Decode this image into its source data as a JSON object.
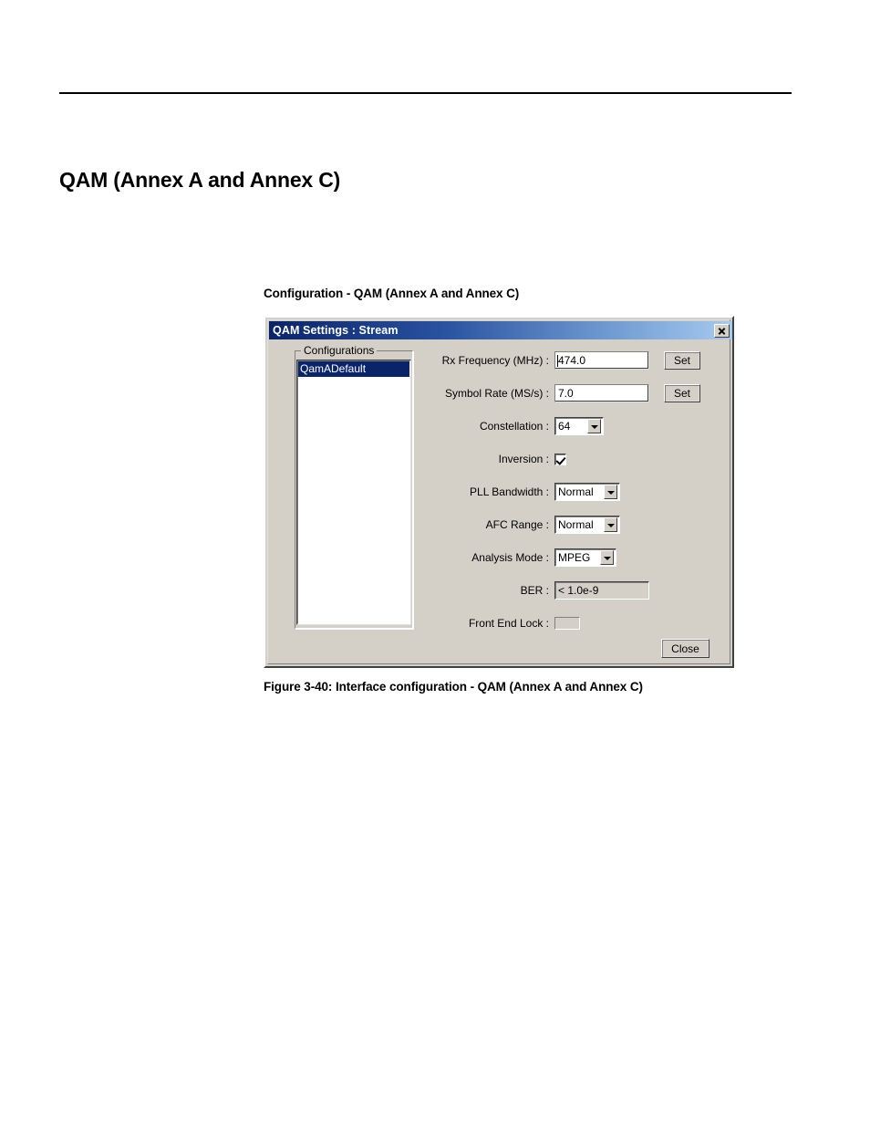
{
  "document": {
    "heading": "QAM (Annex A and Annex C)",
    "figure_label": "Configuration - QAM (Annex A and Annex C)",
    "figure_caption": "Figure 3-40: Interface configuration - QAM (Annex A and Annex C)"
  },
  "dialog": {
    "title": "QAM Settings : Stream",
    "close_icon": "close-x-icon",
    "configurations": {
      "group_label": "Configurations",
      "items": [
        {
          "label": "QamADefault",
          "selected": true
        }
      ]
    },
    "fields": {
      "rx_frequency": {
        "label": "Rx Frequency (MHz) :",
        "value": "474.0",
        "button": "Set"
      },
      "symbol_rate": {
        "label": "Symbol Rate (MS/s) :",
        "value": "7.0",
        "button": "Set"
      },
      "constellation": {
        "label": "Constellation :",
        "value": "64"
      },
      "inversion": {
        "label": "Inversion :",
        "checked": true
      },
      "pll_bandwidth": {
        "label": "PLL Bandwidth :",
        "value": "Normal"
      },
      "afc_range": {
        "label": "AFC Range :",
        "value": "Normal"
      },
      "analysis_mode": {
        "label": "Analysis Mode :",
        "value": "MPEG"
      },
      "ber": {
        "label": "BER :",
        "value": "< 1.0e-9"
      },
      "front_end_lock": {
        "label": "Front End Lock :",
        "status_color": "#ff0000"
      }
    },
    "close_button": "Close"
  },
  "colors": {
    "titlebar_start": "#0a246a",
    "titlebar_end": "#a6caf0",
    "dialog_face": "#d4d0c8",
    "selection": "#0a246a",
    "lock_red": "#ff0000"
  }
}
